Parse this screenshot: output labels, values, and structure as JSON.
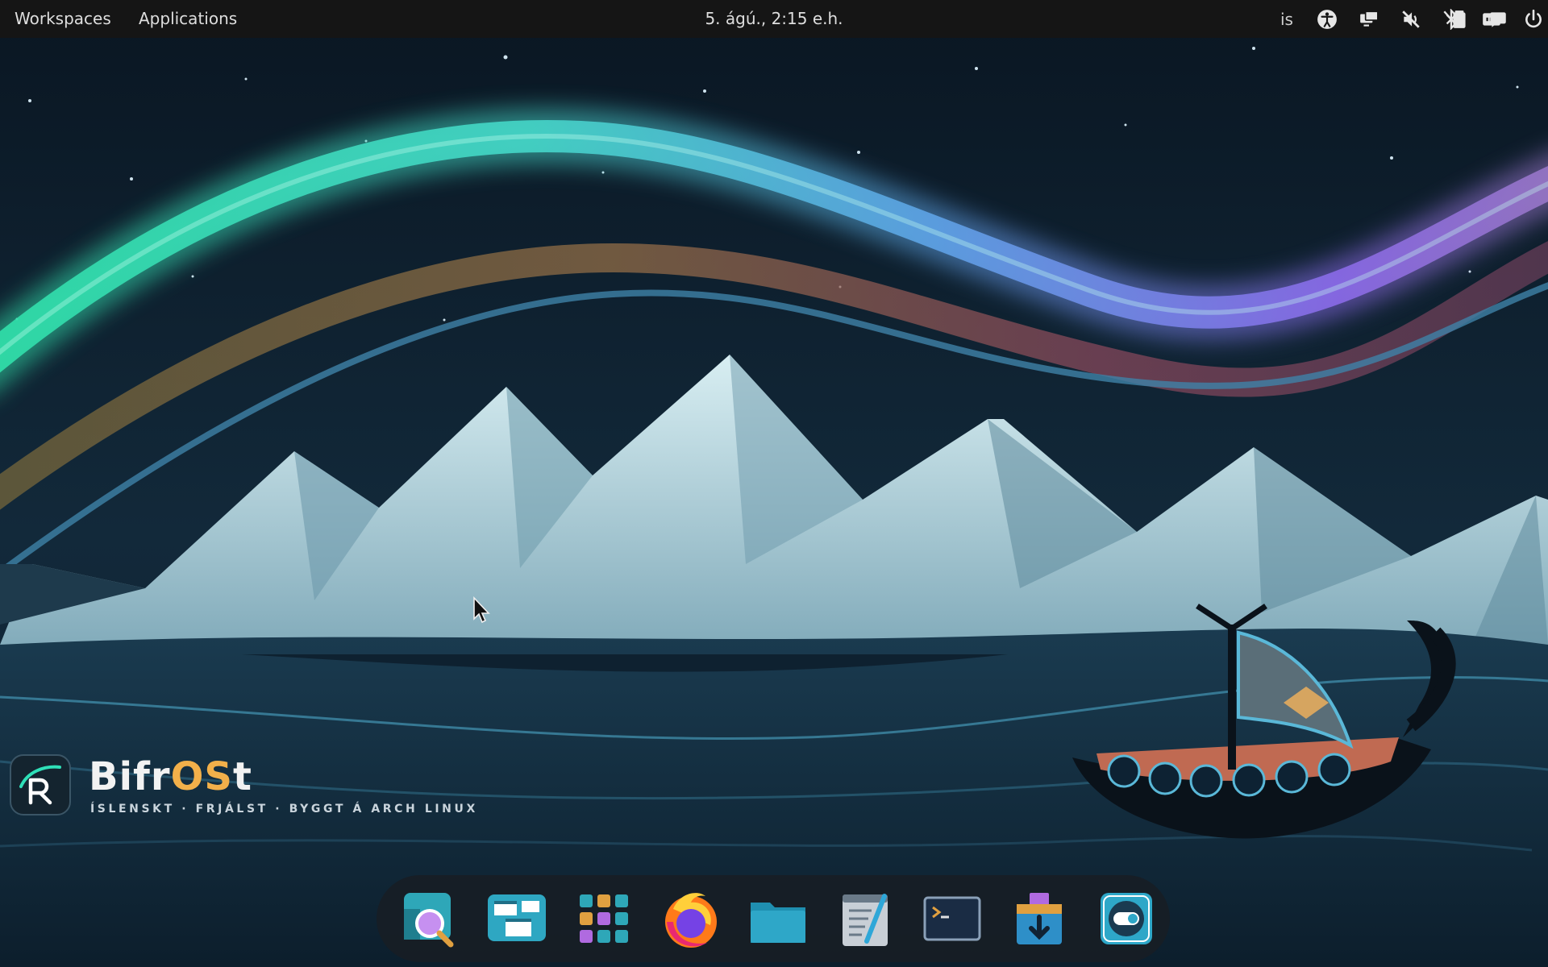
{
  "topbar": {
    "workspaces_label": "Workspaces",
    "applications_label": "Applications",
    "clock": "5. ágú., 2:15 e.h.",
    "keyboard_layout": "is",
    "tray_icons": [
      "accessibility-icon",
      "display-icon",
      "volume-muted-icon",
      "bluetooth-off-icon",
      "network-wired-icon",
      "battery-icon",
      "notifications-icon",
      "power-icon"
    ]
  },
  "branding": {
    "name_prefix": "Bifr",
    "name_highlight": "OS",
    "name_suffix": "t",
    "tagline": "ÍSLENSKT · FRJÁLST · BYGGT Á ARCH LINUX"
  },
  "dock": {
    "apps": [
      "search-app-icon",
      "window-overview-app-icon",
      "app-grid-icon",
      "firefox-icon",
      "files-icon",
      "text-editor-icon",
      "terminal-icon",
      "software-installer-icon",
      "settings-toggle-icon"
    ]
  },
  "colors": {
    "topbar_bg": "#151515",
    "brand_accent": "#f2b04a",
    "sky": "#0b1a27",
    "aurora_green": "#2fe0a8",
    "aurora_purple": "#8a6ae8"
  }
}
